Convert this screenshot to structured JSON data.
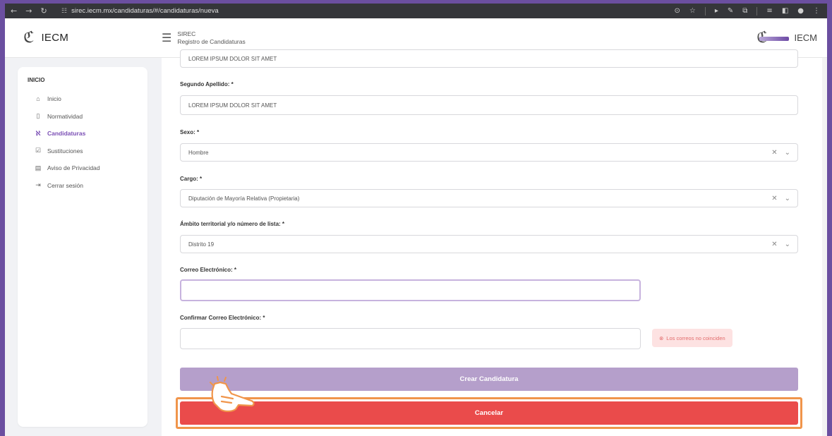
{
  "browser": {
    "url": "sirec.iecm.mx/candidaturas/#/candidaturas/nueva"
  },
  "header": {
    "brand": "IECM",
    "system": "SIREC",
    "subtitle": "Registro de Candidaturas",
    "right_brand": "IECM"
  },
  "sidebar": {
    "heading": "INICIO",
    "items": [
      {
        "label": "Inicio",
        "icon": "home-icon"
      },
      {
        "label": "Normatividad",
        "icon": "document-icon"
      },
      {
        "label": "Candidaturas",
        "icon": "users-icon",
        "active": true
      },
      {
        "label": "Sustituciones",
        "icon": "check-square-icon"
      },
      {
        "label": "Aviso de Privacidad",
        "icon": "list-icon"
      },
      {
        "label": "Cerrar sesión",
        "icon": "logout-icon"
      }
    ]
  },
  "form": {
    "primer_apellido_value": "LOREM IPSUM DOLOR SIT AMET",
    "segundo_apellido_label": "Segundo Apellido: *",
    "segundo_apellido_value": "LOREM IPSUM DOLOR SIT AMET",
    "sexo_label": "Sexo: *",
    "sexo_value": "Hombre",
    "cargo_label": "Cargo: *",
    "cargo_value": "Diputación de Mayoría Relativa (Propietaria)",
    "ambito_label": "Ámbito territorial y/o número de lista: *",
    "ambito_value": "Distrito 19",
    "correo_label": "Correo Electrónico: *",
    "correo_value": "",
    "confirmar_label": "Confirmar Correo Electrónico: *",
    "confirmar_value": "",
    "error_message": "Los correos no coinciden",
    "create_button": "Crear Candidatura",
    "cancel_button": "Cancelar"
  },
  "colors": {
    "accent": "#7b4fb5",
    "create_button": "#b59fcb",
    "cancel_button": "#ea4b4b",
    "highlight": "#f0954b",
    "error_bg": "#fde2e2"
  }
}
